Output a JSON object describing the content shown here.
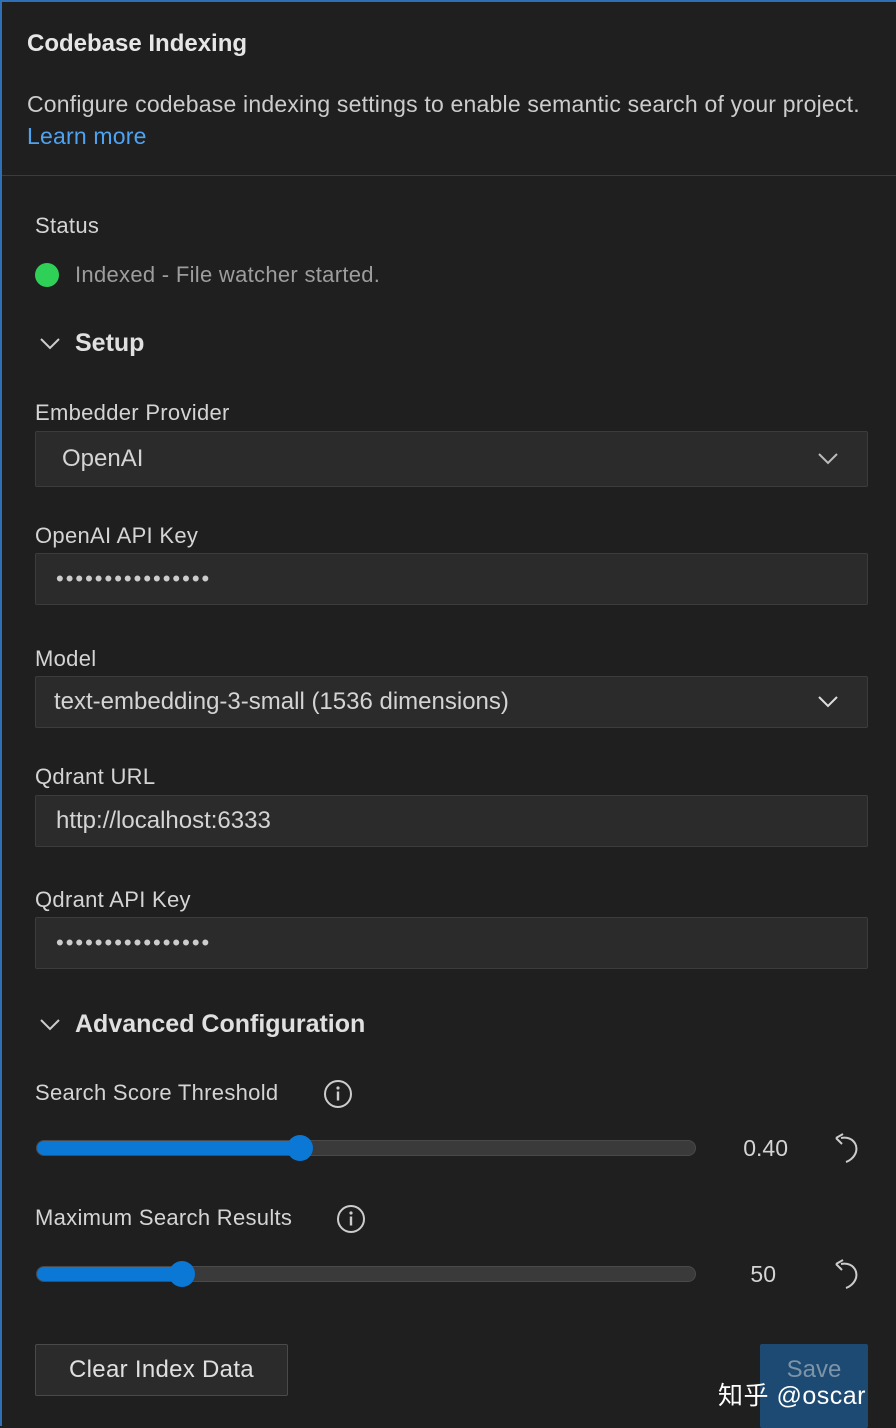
{
  "header": {
    "title": "Codebase Indexing",
    "description": "Configure codebase indexing settings to enable semantic search of your project.",
    "learn_more": "Learn more"
  },
  "status": {
    "label": "Status",
    "text": "Indexed - File watcher started.",
    "color": "#2fd058"
  },
  "setup": {
    "section_label": "Setup",
    "embedder_label": "Embedder Provider",
    "embedder_value": "OpenAI",
    "api_key_label": "OpenAI API Key",
    "api_key_mask": "••••••••••••••••",
    "model_label": "Model",
    "model_value": "text-embedding-3-small (1536 dimensions)",
    "qdrant_url_label": "Qdrant URL",
    "qdrant_url_value": "http://localhost:6333",
    "qdrant_key_label": "Qdrant API Key",
    "qdrant_key_mask": "••••••••••••••••"
  },
  "advanced": {
    "section_label": "Advanced Configuration",
    "threshold_label": "Search Score Threshold",
    "threshold_value": "0.40",
    "threshold_fraction": 0.4,
    "max_results_label": "Maximum Search Results",
    "max_results_value": "50",
    "max_results_fraction": 0.22
  },
  "buttons": {
    "clear": "Clear Index Data",
    "save": "Save"
  },
  "watermark": "知乎 @oscar",
  "colors": {
    "accent": "#0a78d4",
    "link": "#4ea3f1",
    "status_ok": "#2fd058"
  }
}
